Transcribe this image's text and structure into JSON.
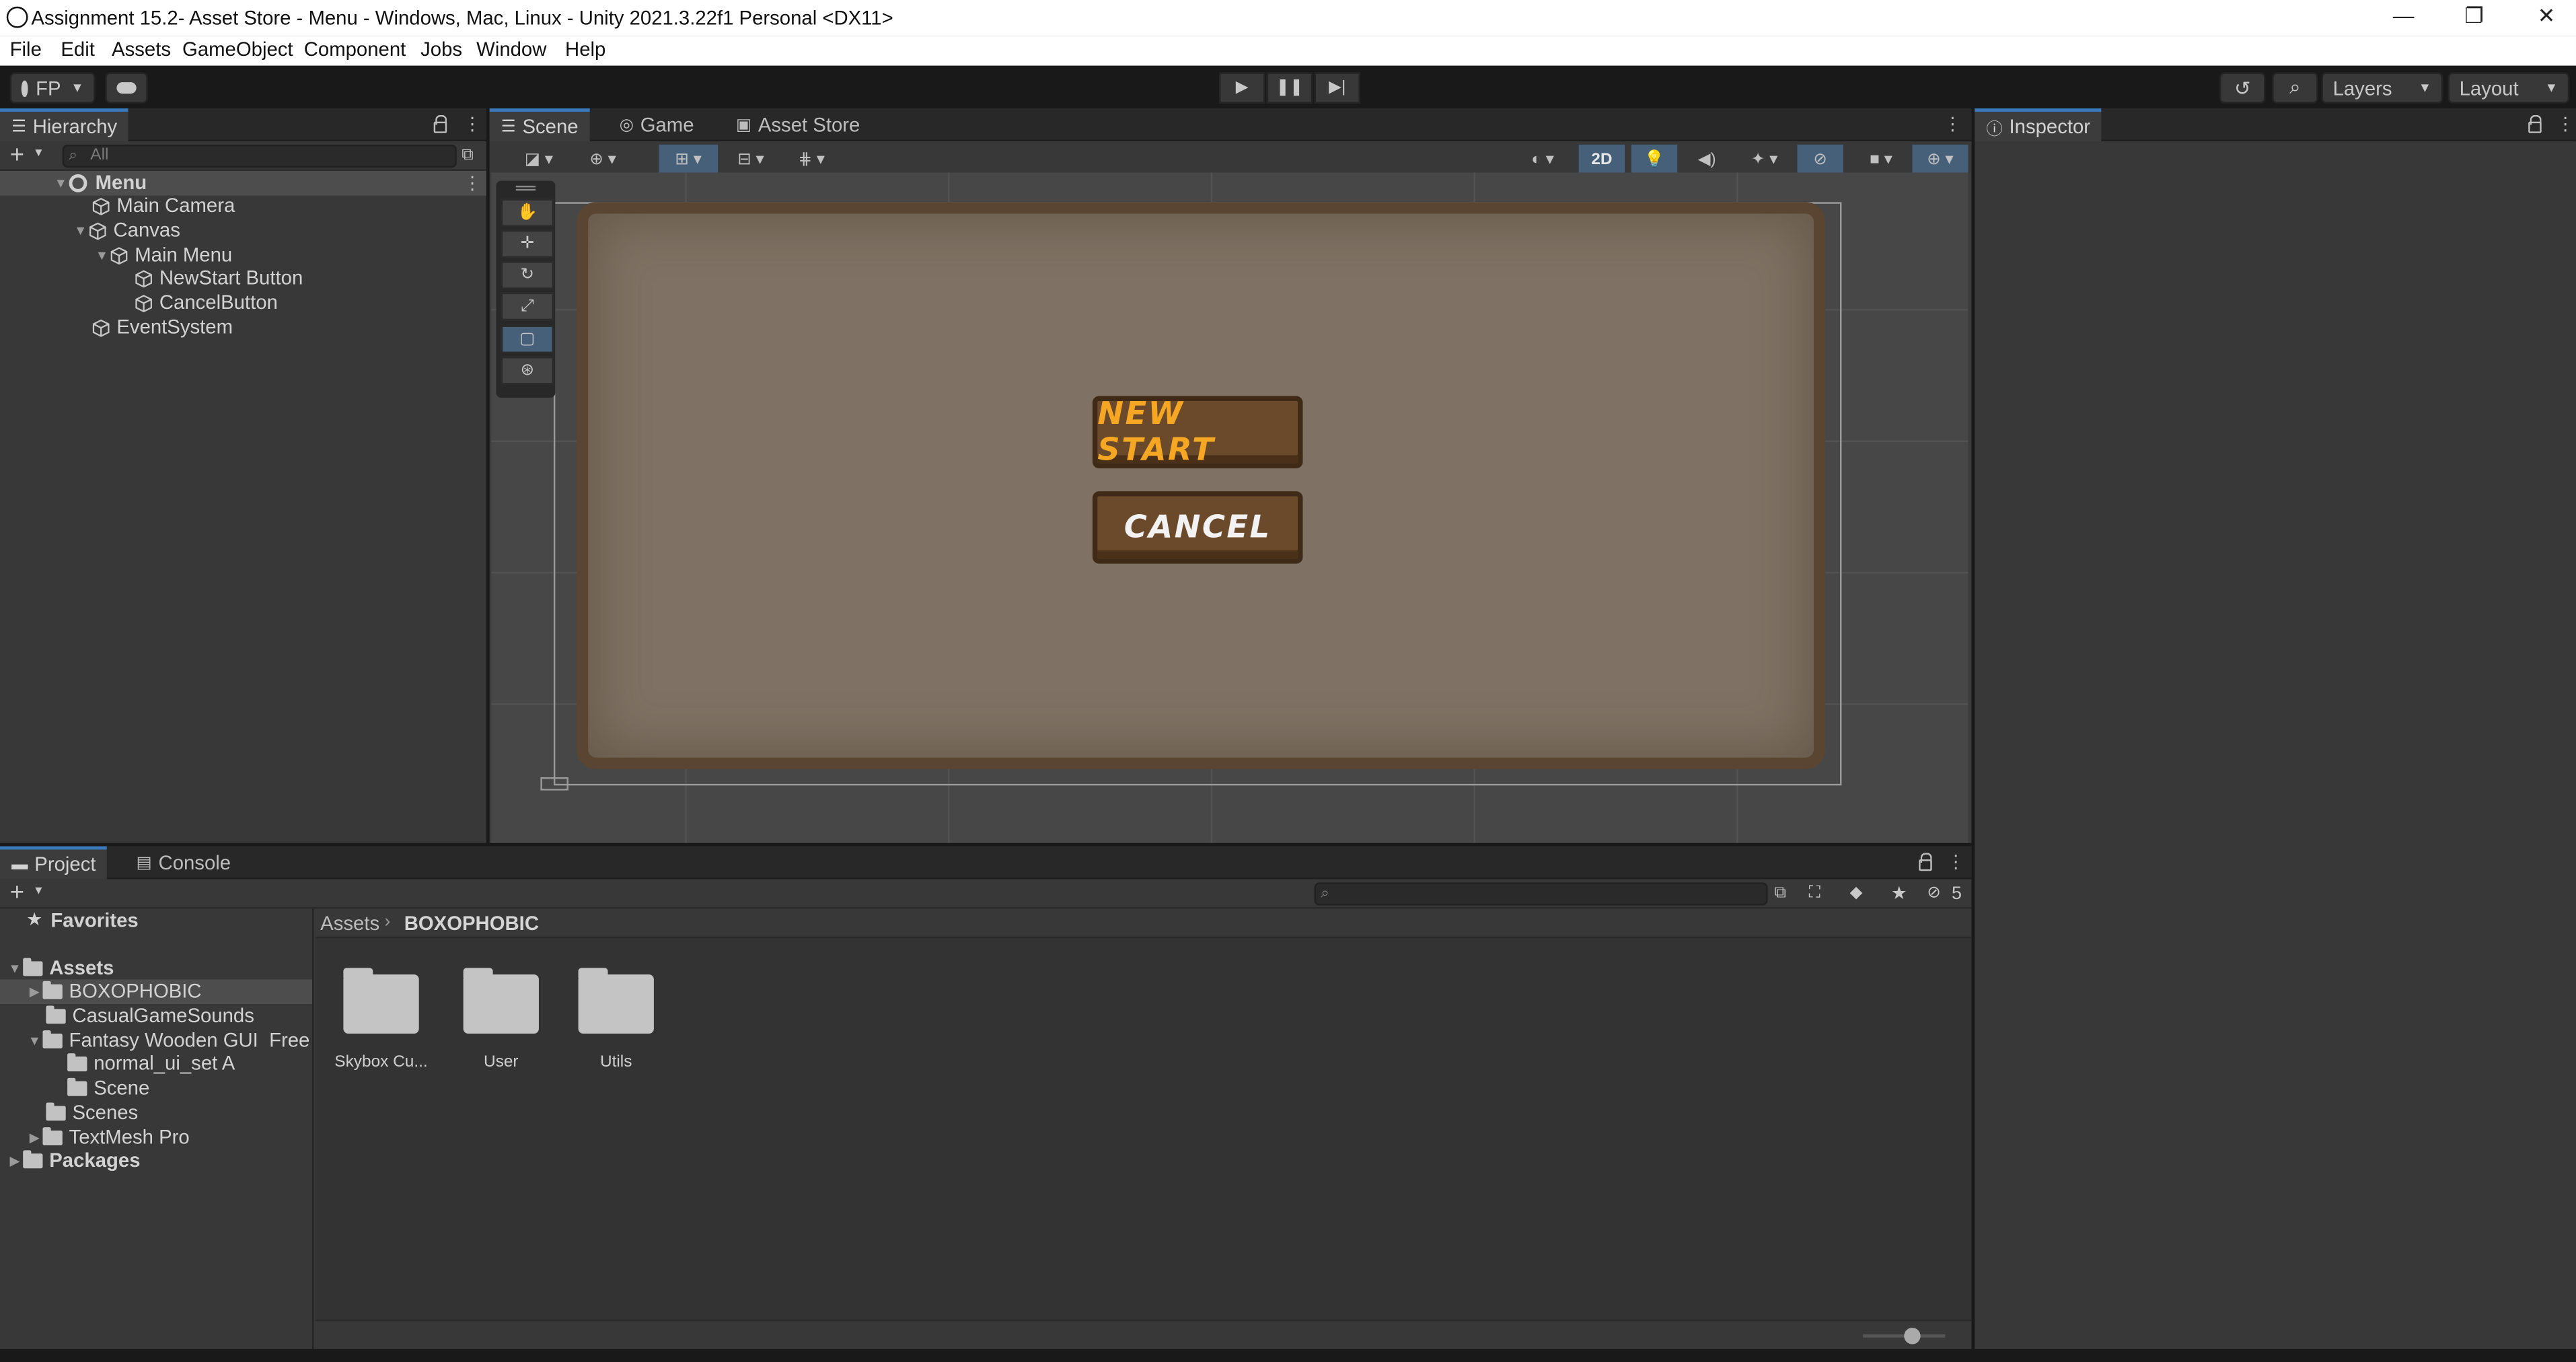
{
  "window": {
    "title": "Assignment 15.2- Asset Store - Menu - Windows, Mac, Linux - Unity 2021.3.22f1 Personal <DX11>",
    "minimize": "—",
    "restore": "❐",
    "close": "✕"
  },
  "menu": [
    "File",
    "Edit",
    "Assets",
    "GameObject",
    "Component",
    "Jobs",
    "Window",
    "Help"
  ],
  "toolbar": {
    "account": "FP",
    "play_icon": "play-icon",
    "layers_label": "Layers",
    "layout_label": "Layout"
  },
  "hierarchy": {
    "tab": "Hierarchy",
    "search_placeholder": "All",
    "scene_name": "Menu",
    "items": [
      {
        "label": "Main Camera"
      },
      {
        "label": "Canvas"
      },
      {
        "label": "Main Menu"
      },
      {
        "label": "NewStart Button"
      },
      {
        "label": "CancelButton"
      },
      {
        "label": "EventSystem"
      }
    ]
  },
  "scene": {
    "tabs": [
      "Scene",
      "Game",
      "Asset Store"
    ],
    "mode_2d": "2D",
    "buttons": {
      "new_start": "NEW START",
      "cancel": "CANCEL"
    },
    "button_colors": {
      "new_start_text": "#f5a623",
      "cancel_text": "#f2f2f2"
    }
  },
  "inspector": {
    "tab": "Inspector"
  },
  "project": {
    "tabs": [
      "Project",
      "Console"
    ],
    "hidden_count": "5",
    "breadcrumb": [
      "Assets",
      "BOXOPHOBIC"
    ],
    "favorites": "Favorites",
    "tree": {
      "assets": "Assets",
      "items": [
        {
          "label": "BOXOPHOBIC"
        },
        {
          "label": "CasualGameSounds"
        },
        {
          "label": "Fantasy Wooden GUI  Free"
        },
        {
          "label": "normal_ui_set A"
        },
        {
          "label": "Scene"
        },
        {
          "label": "Scenes"
        },
        {
          "label": "TextMesh Pro"
        }
      ],
      "packages": "Packages"
    },
    "folders": [
      {
        "label": "Skybox Cu..."
      },
      {
        "label": "User"
      },
      {
        "label": "Utils"
      }
    ]
  },
  "colors": {
    "accent": "#3a79bb",
    "panel": "#383838",
    "selected": "#4d4d4d"
  }
}
